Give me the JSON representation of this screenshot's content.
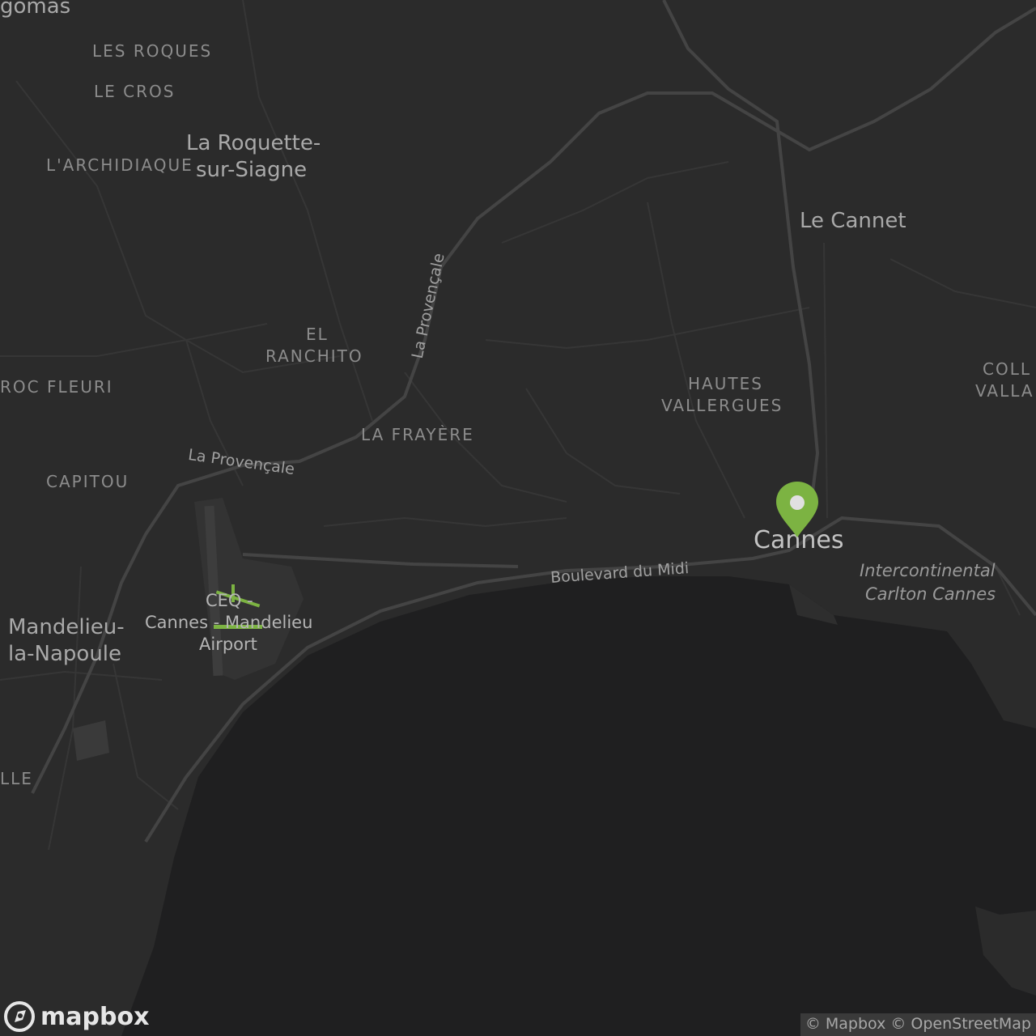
{
  "labels": {
    "gomas": "gomas",
    "les_roques": "LES ROQUES",
    "le_cros": "LE CROS",
    "la_roquette_1": "La Roquette-",
    "la_roquette_2": "sur-Siagne",
    "archidiaque": "L'ARCHIDIAQUE",
    "el": "EL",
    "ranchito": "RANCHITO",
    "roc_fleuri": "ROC FLEURI",
    "la_frayere": "LA FRAYÈRE",
    "capitou": "CAPITOU",
    "mandelieu_1": "Mandelieu-",
    "mandelieu_2": "la-Napoule",
    "lle": "LLE",
    "le_cannet": "Le Cannet",
    "hautes": "HAUTES",
    "vallergues": "VALLERGUES",
    "coll": "COLL",
    "valla": "VALLA",
    "cannes": "Cannes",
    "intercontinental_1": "Intercontinental",
    "intercontinental_2": "Carlton Cannes",
    "airport_code": "CEQ -",
    "airport_1": "Cannes - Mandelieu",
    "airport_2": "Airport"
  },
  "roads": {
    "provencale_vertical": "La Provençale",
    "provencale_curve": "La Provençale",
    "boulevard_midi": "Boulevard du Midi"
  },
  "marker": {
    "color": "#7cb342",
    "label": "Cannes"
  },
  "attribution": {
    "mapbox": "© Mapbox",
    "osm": "© OpenStreetMap"
  },
  "logo": {
    "text": "mapbox"
  },
  "colors": {
    "land": "#2b2b2b",
    "water": "#1f1f20",
    "road": "#3f3f3f",
    "accent": "#7cb342"
  }
}
